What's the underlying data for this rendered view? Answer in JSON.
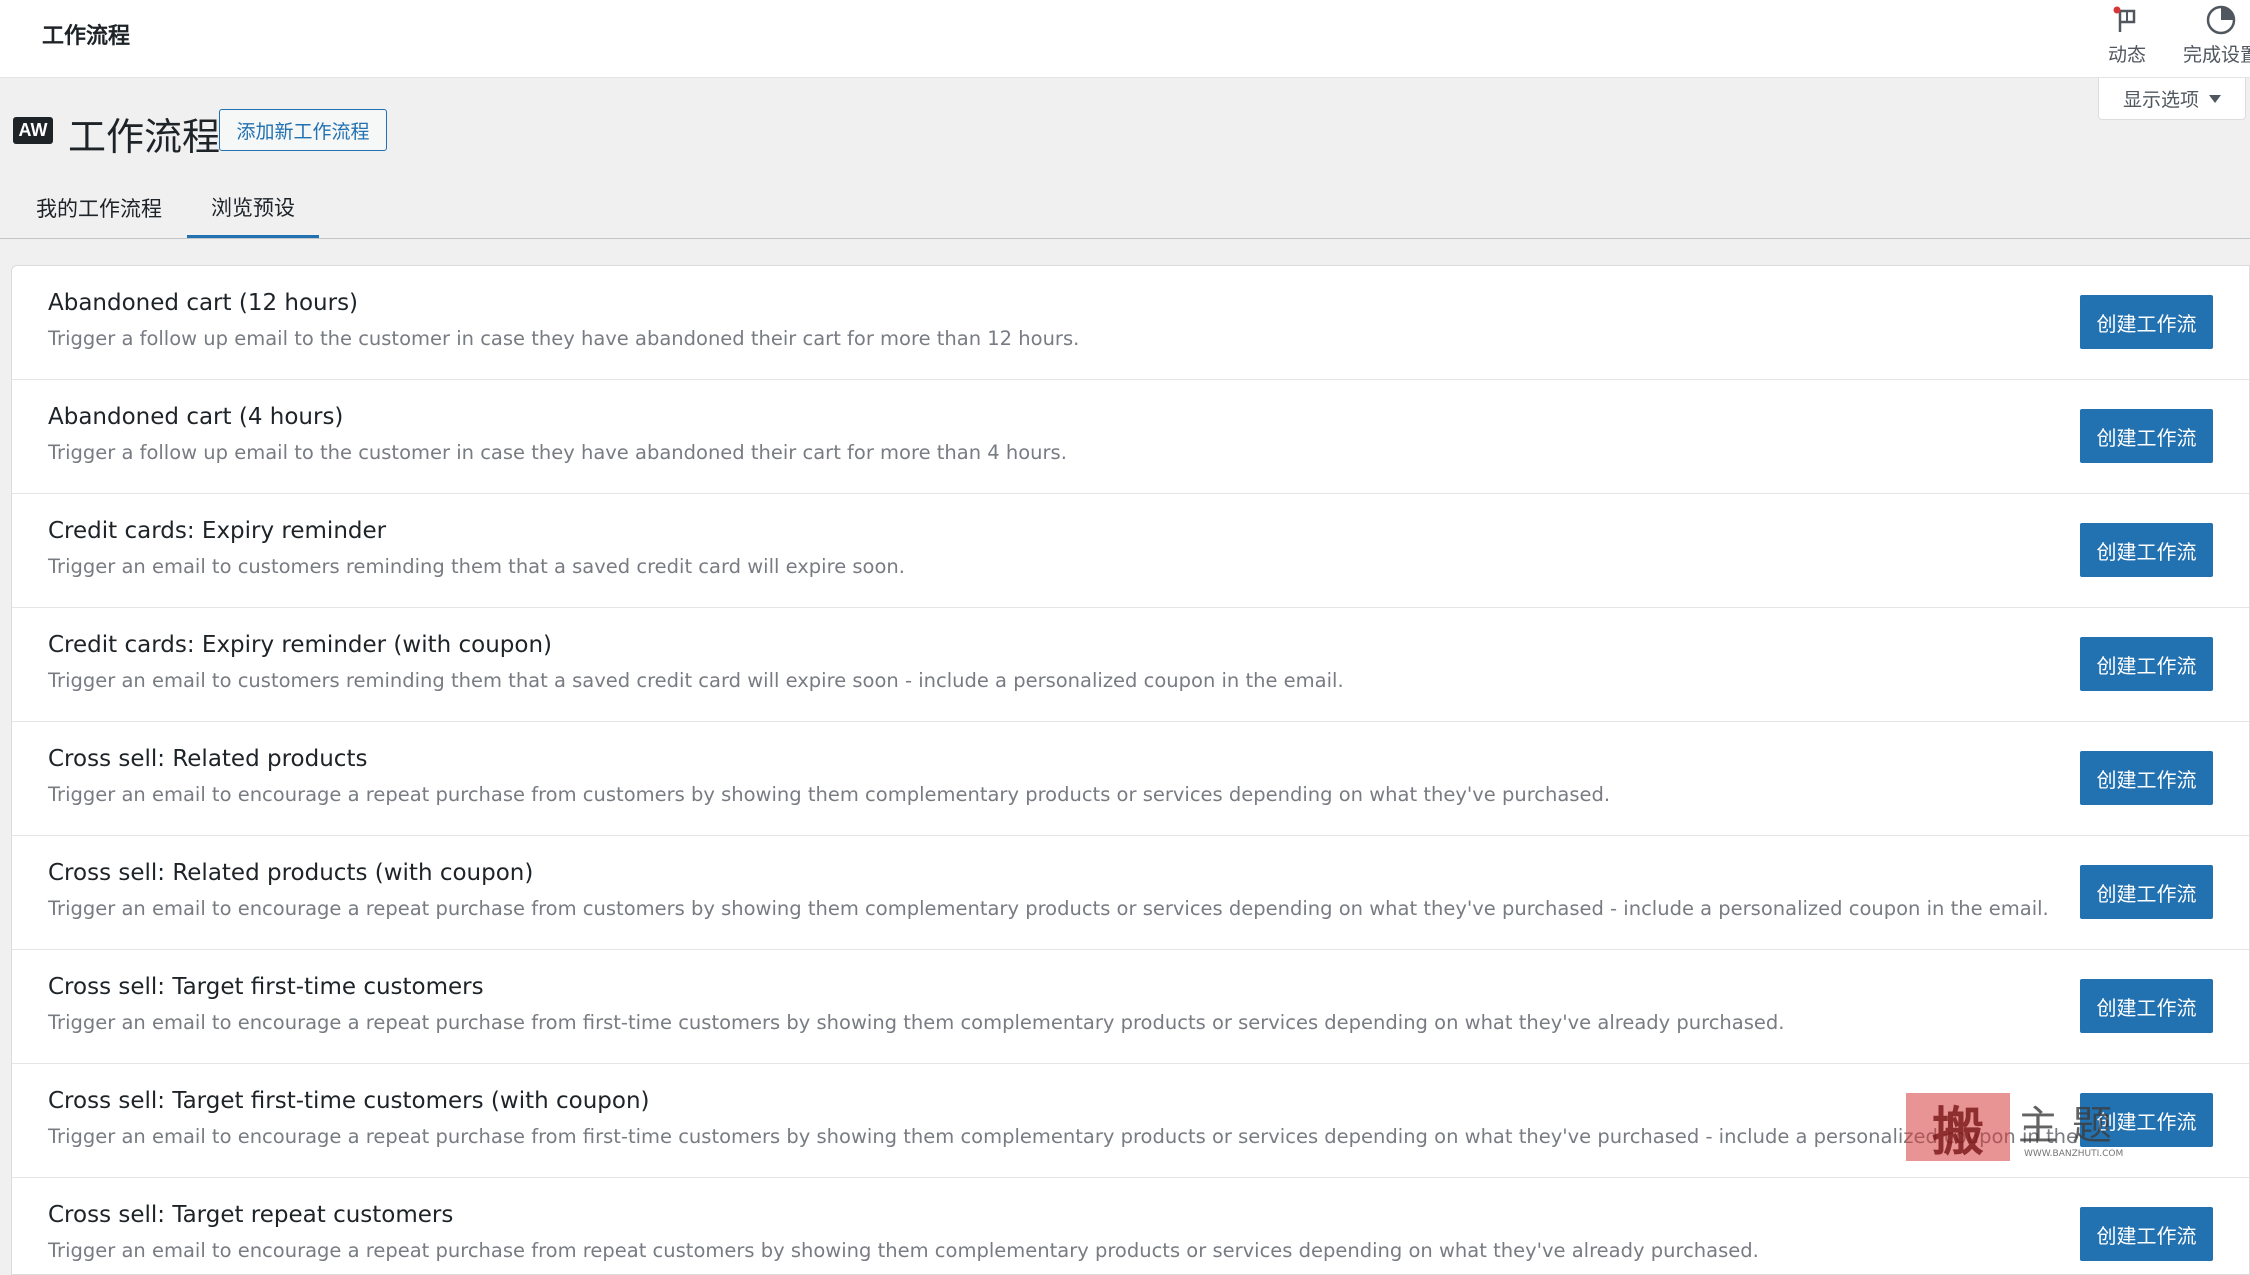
{
  "topbar": {
    "title": "工作流程",
    "activity_label": "动态",
    "finish_setup_label": "完成设置"
  },
  "screen_options": {
    "label": "显示选项"
  },
  "header": {
    "logo_text": "AW",
    "title": "工作流程",
    "add_new_label": "添加新工作流程"
  },
  "tabs": [
    {
      "label": "我的工作流程",
      "active": false
    },
    {
      "label": "浏览预设",
      "active": true
    }
  ],
  "accent_color": "#2271b1",
  "presets": [
    {
      "title": "Abandoned cart (12 hours)",
      "description": "Trigger a follow up email to the customer in case they have abandoned their cart for more than 12 hours.",
      "button": "创建工作流"
    },
    {
      "title": "Abandoned cart (4 hours)",
      "description": "Trigger a follow up email to the customer in case they have abandoned their cart for more than 4 hours.",
      "button": "创建工作流"
    },
    {
      "title": "Credit cards: Expiry reminder",
      "description": "Trigger an email to customers reminding them that a saved credit card will expire soon.",
      "button": "创建工作流"
    },
    {
      "title": "Credit cards: Expiry reminder (with coupon)",
      "description": "Trigger an email to customers reminding them that a saved credit card will expire soon - include a personalized coupon in the email.",
      "button": "创建工作流"
    },
    {
      "title": "Cross sell: Related products",
      "description": "Trigger an email to encourage a repeat purchase from customers by showing them complementary products or services depending on what they've purchased.",
      "button": "创建工作流"
    },
    {
      "title": "Cross sell: Related products (with coupon)",
      "description": "Trigger an email to encourage a repeat purchase from customers by showing them complementary products or services depending on what they've purchased - include a personalized coupon in the email.",
      "button": "创建工作流"
    },
    {
      "title": "Cross sell: Target first-time customers",
      "description": "Trigger an email to encourage a repeat purchase from first-time customers by showing them complementary products or services depending on what they've already purchased.",
      "button": "创建工作流"
    },
    {
      "title": "Cross sell: Target first-time customers (with coupon)",
      "description": "Trigger an email to encourage a repeat purchase from first-time customers by showing them complementary products or services depending on what they've purchased - include a personalized coupon in the email.",
      "button": "创建工作流"
    },
    {
      "title": "Cross sell: Target repeat customers",
      "description": "Trigger an email to encourage a repeat purchase from repeat customers by showing them complementary products or services depending on what they've already purchased.",
      "button": "创建工作流"
    }
  ],
  "watermark": {
    "seal": "搬",
    "text": "主题",
    "url": "WWW.BANZHUTI.COM"
  }
}
